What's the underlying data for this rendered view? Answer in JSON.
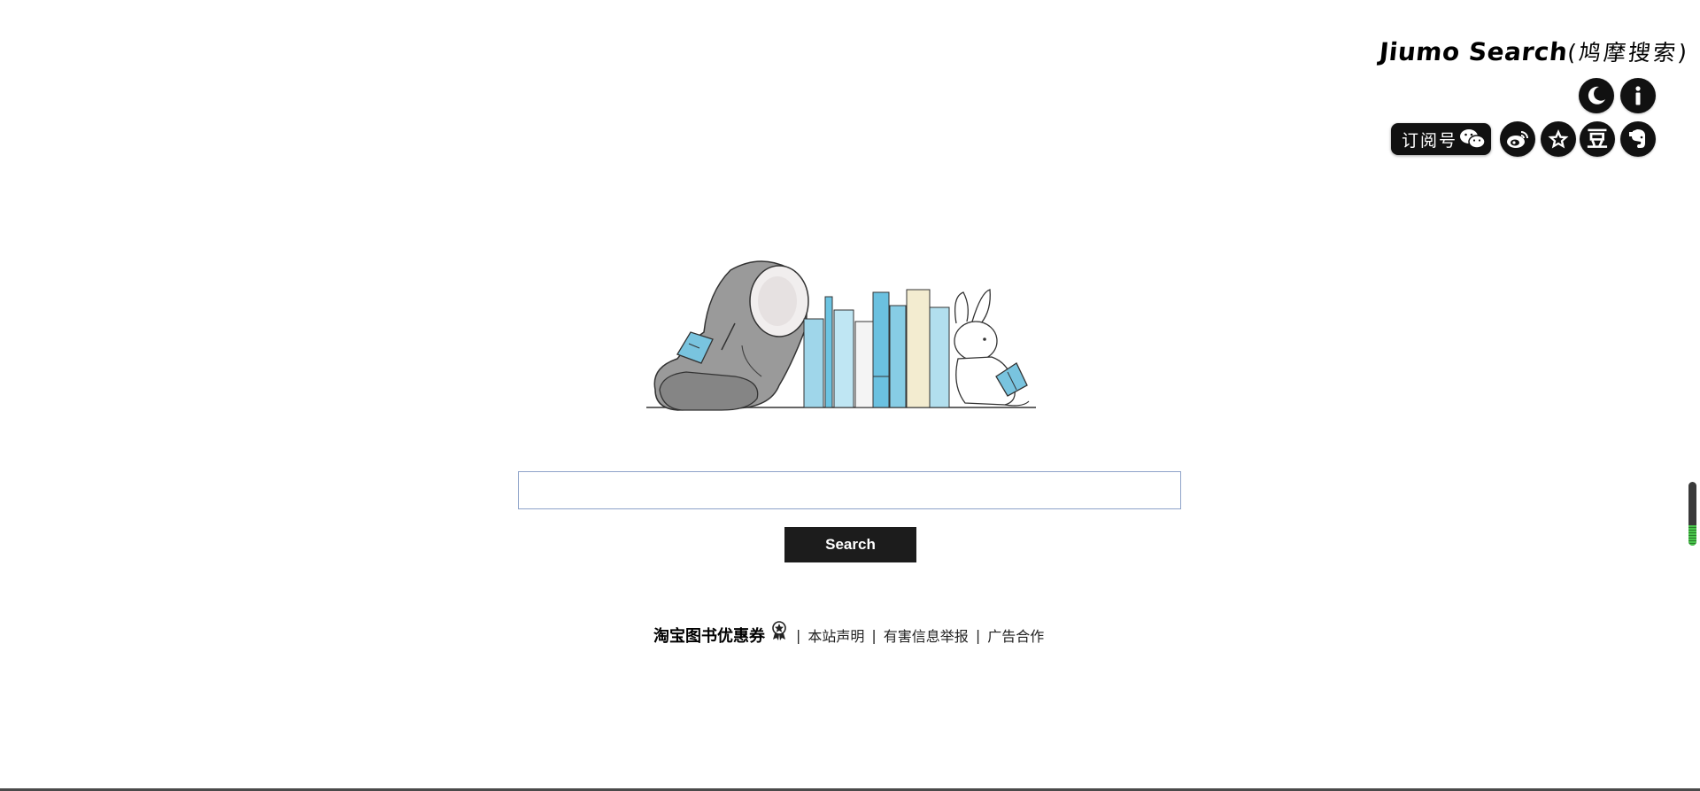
{
  "header": {
    "brand_main": "Jiumo Search",
    "brand_sub": "(鸠摩搜索)",
    "icons": [
      {
        "name": "night-mode-icon"
      },
      {
        "name": "info-icon"
      }
    ],
    "social": {
      "subscribe_label": "订阅号",
      "subscribe_icon": "wechat-icon",
      "douban_glyph": "豆",
      "items": [
        "weibo-icon",
        "star-icon",
        "douban-icon",
        "evernote-icon"
      ]
    }
  },
  "search": {
    "input_value": "",
    "placeholder": "",
    "button_label": "Search"
  },
  "footer": {
    "promo_label": "淘宝图书优惠券",
    "sep": "|",
    "links": [
      "本站声明",
      "有害信息举报",
      "广告合作"
    ]
  },
  "scroll_indicator": {
    "fill_fraction": 0.32,
    "fill_color": "#49c44b"
  }
}
